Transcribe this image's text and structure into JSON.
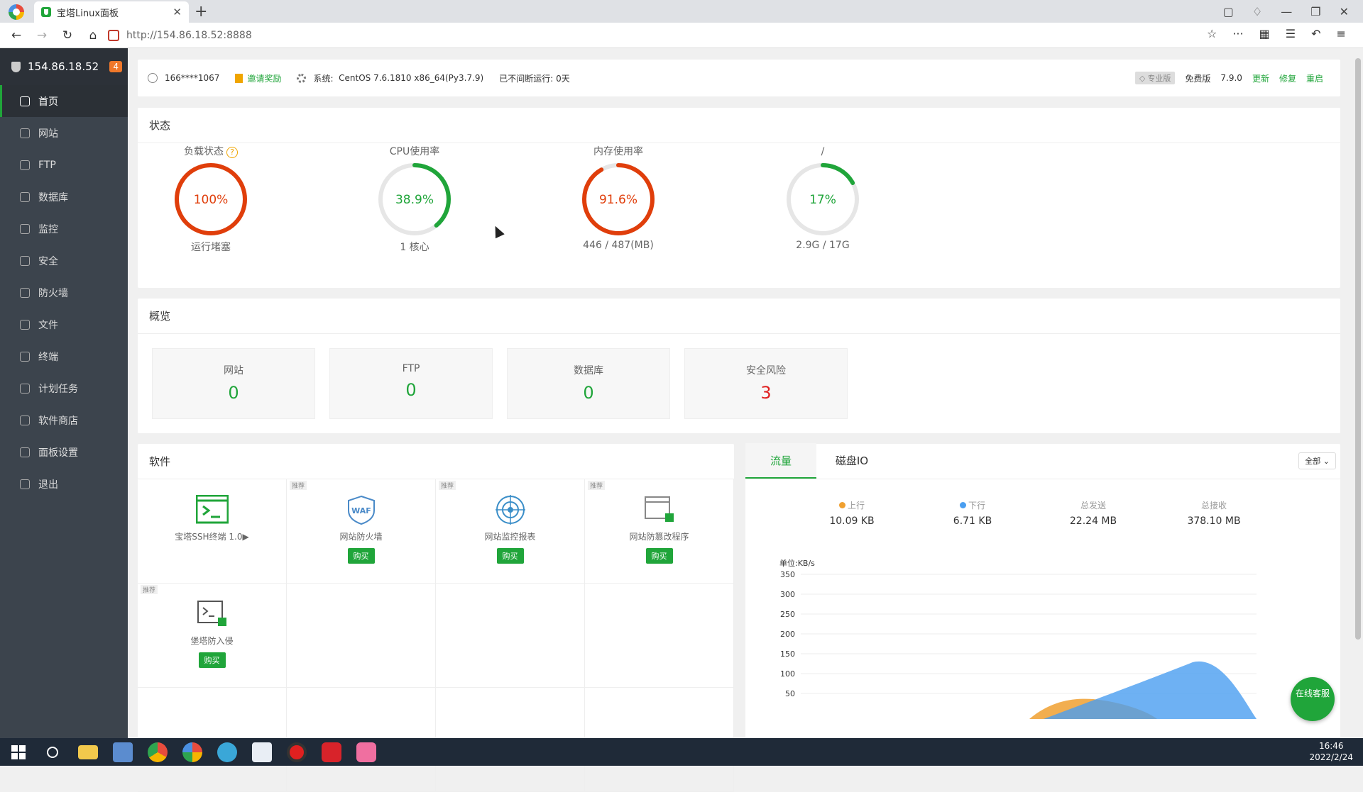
{
  "browser": {
    "tab_title": "宝塔Linux面板",
    "url": "http://154.86.18.52:8888"
  },
  "sidebar": {
    "server_ip": "154.86.18.52",
    "badge": "4",
    "items": [
      {
        "label": "首页",
        "icon": "home-icon"
      },
      {
        "label": "网站",
        "icon": "globe-icon"
      },
      {
        "label": "FTP",
        "icon": "ftp-icon"
      },
      {
        "label": "数据库",
        "icon": "database-icon"
      },
      {
        "label": "监控",
        "icon": "monitor-icon"
      },
      {
        "label": "安全",
        "icon": "shield-icon"
      },
      {
        "label": "防火墙",
        "icon": "firewall-icon"
      },
      {
        "label": "文件",
        "icon": "folder-icon"
      },
      {
        "label": "终端",
        "icon": "terminal-icon"
      },
      {
        "label": "计划任务",
        "icon": "calendar-icon"
      },
      {
        "label": "软件商店",
        "icon": "apps-icon"
      },
      {
        "label": "面板设置",
        "icon": "gear-icon"
      },
      {
        "label": "退出",
        "icon": "logout-icon"
      }
    ]
  },
  "topbar": {
    "user": "166****1067",
    "invite": "邀请奖励",
    "system_label": "系统:",
    "system_value": "CentOS 7.6.1810 x86_64(Py3.7.9)",
    "uptime": "已不间断运行: 0天",
    "pro_tag": "专业版",
    "edition": "免费版",
    "version": "7.9.0",
    "update": "更新",
    "repair": "修复",
    "restart": "重启"
  },
  "status": {
    "title": "状态",
    "gauges": [
      {
        "label": "负载状态",
        "value": "100%",
        "percent": 100,
        "sub": "运行堵塞",
        "color": "#e03e0b",
        "help": "?"
      },
      {
        "label": "CPU使用率",
        "value": "38.9%",
        "percent": 38.9,
        "sub": "1 核心",
        "color": "#20a53a"
      },
      {
        "label": "内存使用率",
        "value": "91.6%",
        "percent": 91.6,
        "sub": "446 / 487(MB)",
        "color": "#e03e0b"
      },
      {
        "label": "/",
        "value": "17%",
        "percent": 17,
        "sub": "2.9G / 17G",
        "color": "#20a53a"
      }
    ]
  },
  "overview": {
    "title": "概览",
    "boxes": [
      {
        "label": "网站",
        "value": "0"
      },
      {
        "label": "FTP",
        "value": "0"
      },
      {
        "label": "数据库",
        "value": "0"
      },
      {
        "label": "安全风险",
        "value": "3"
      }
    ]
  },
  "software": {
    "title": "软件",
    "rec_label": "推荐",
    "buy_label": "购买",
    "items": [
      {
        "name": "宝塔SSH终端 1.0▶",
        "icon": "ssh-terminal-icon",
        "recommended": false,
        "buy": false
      },
      {
        "name": "网站防火墙",
        "icon": "waf-icon",
        "recommended": true,
        "buy": true,
        "icon_text": "WAF"
      },
      {
        "name": "网站监控报表",
        "icon": "radar-icon",
        "recommended": true,
        "buy": true
      },
      {
        "name": "网站防篡改程序",
        "icon": "tamper-proof-icon",
        "recommended": true,
        "buy": true
      },
      {
        "name": "堡塔防入侵",
        "icon": "intrusion-icon",
        "recommended": true,
        "buy": true
      }
    ]
  },
  "traffic": {
    "tabs": [
      "流量",
      "磁盘IO"
    ],
    "select": "全部",
    "stats": [
      {
        "label": "上行",
        "value": "10.09 KB",
        "dot": "#f0a030"
      },
      {
        "label": "下行",
        "value": "6.71 KB",
        "dot": "#4a9ef0"
      },
      {
        "label": "总发送",
        "value": "22.24 MB"
      },
      {
        "label": "总接收",
        "value": "378.10 MB"
      }
    ],
    "chart_data": {
      "type": "area",
      "ylabel": "单位:KB/s",
      "y_ticks": [
        350,
        300,
        250,
        200,
        150,
        100,
        50
      ],
      "series": [
        {
          "name": "上行",
          "color": "#f0a030"
        },
        {
          "name": "下行",
          "color": "#4a9ef0"
        }
      ]
    }
  },
  "chat": {
    "label": "在线客服"
  },
  "taskbar": {
    "time": "16:46",
    "date": "2022/2/24"
  }
}
